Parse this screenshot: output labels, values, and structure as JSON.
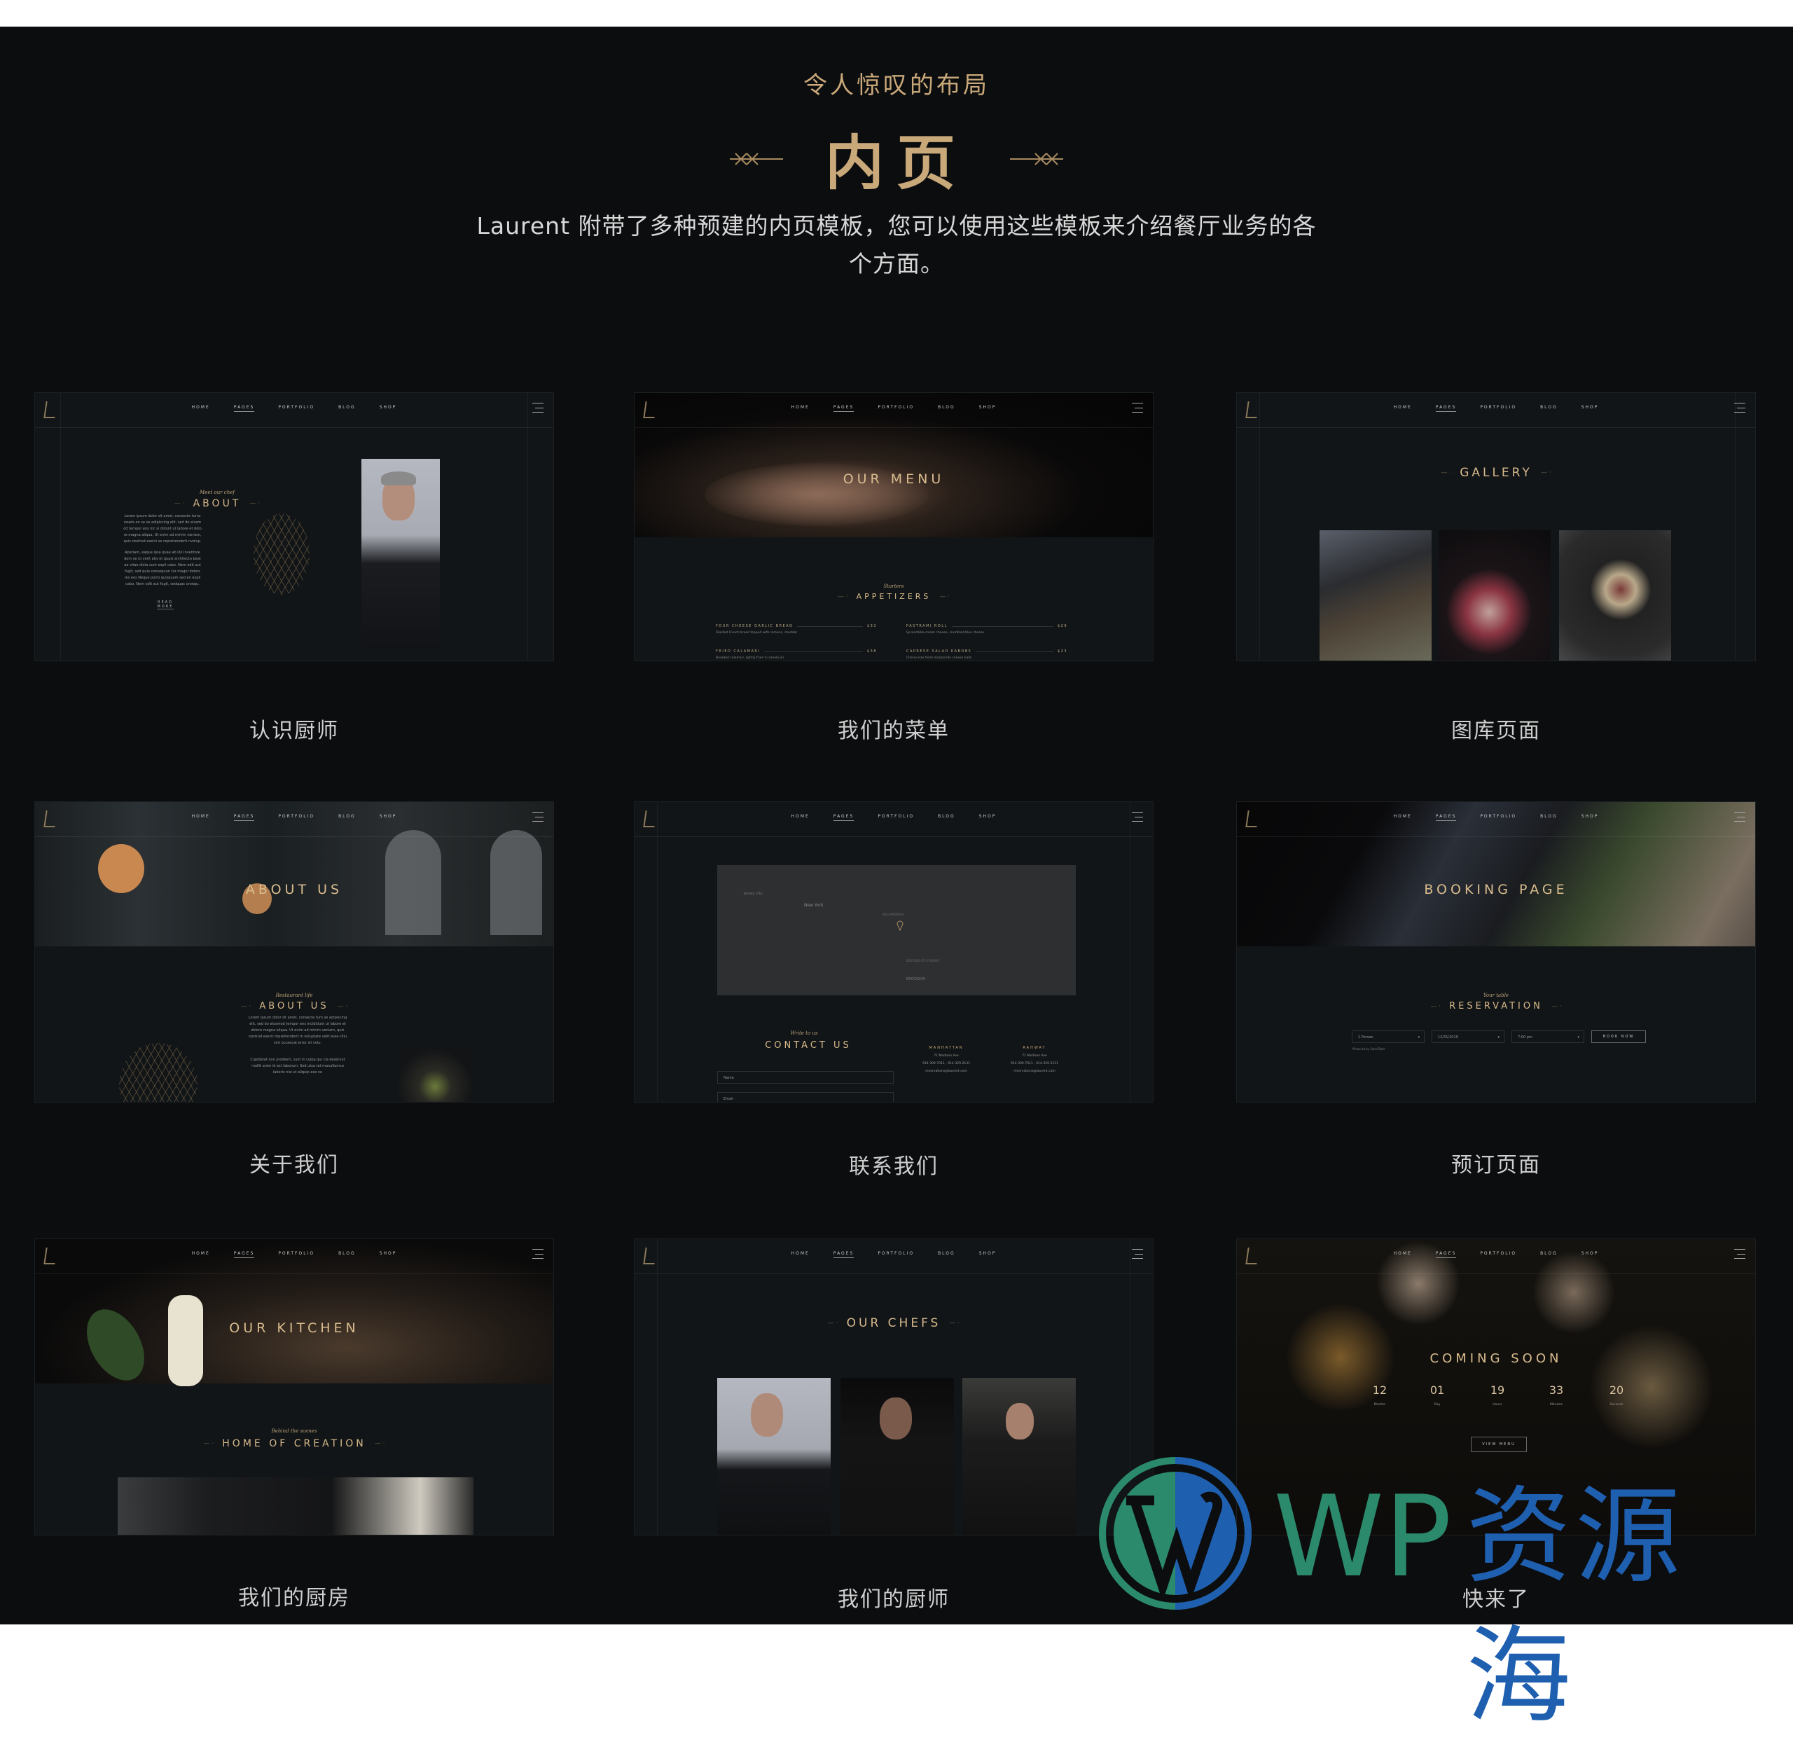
{
  "header": {
    "eyebrow": "令人惊叹的布局",
    "title": "内页",
    "description": "Laurent 附带了多种预建的内页模板，您可以使用这些模板来介绍餐厅业务的各个方面。"
  },
  "site_nav": {
    "items": [
      "HOME",
      "PAGES",
      "PORTFOLIO",
      "BLOG",
      "SHOP"
    ],
    "active": "PAGES"
  },
  "colors": {
    "background": "#0c0d0f",
    "accent_gold": "#c9a87a",
    "caption": "#cfcfcf"
  },
  "cards": [
    {
      "caption": "认识厨师",
      "preview": {
        "script": "Meet our chef",
        "title": "ABOUT",
        "para1": "Lorem ipsum dolor sit amet, consecte turns neads en se se adipiscing elit, sed do eiusm od tempor ens inc si didunt ut labore et dolo re magna aliqua. Ut enim ad minim veniam, quis nostrud exerci se reprehenderit nvolup.",
        "para2": "Aperiam, eaque ipsa quae ab illo inventore dom se ro verit atis et quasi architecto beat ae vitae dicta sunt expli cabo. Nem odit aut fugit, sed quia consequun tur magni dolors res eos Neque porro quisquam sed en expli cabo. Nem odit aut fugit, sedquac oroequ.",
        "link": "READ MORE"
      }
    },
    {
      "caption": "我们的菜单",
      "preview": {
        "hero_title": "OUR MENU",
        "script": "Starters",
        "title": "APPETIZERS",
        "items": [
          {
            "name": "FOUR CHEESE GARLIC BREAD",
            "price": "$32",
            "desc": "Toasted French bread topped with romano, cheddar"
          },
          {
            "name": "PASTRAMI ROLL",
            "price": "$29",
            "desc": "Spreadable cream cheese, crumbled blue cheese"
          },
          {
            "name": "FRIED CALAMARI",
            "price": "$38",
            "desc": "Breaded calamari, lightly fried in canola oil"
          },
          {
            "name": "CAPRESE SALAD KABOBS",
            "price": "$23",
            "desc": "Cherry-size fresh mozzarella cheese balls"
          }
        ]
      }
    },
    {
      "caption": "图库页面",
      "preview": {
        "title": "GALLERY"
      }
    },
    {
      "caption": "关于我们",
      "preview": {
        "hero_title": "ABOUT US",
        "script": "Restaurant life",
        "title": "ABOUT US",
        "para1": "Lorem ipsum dolor sit amet, consecte turn se adipiscing elit, sed do eiusmod tempor ens incididunt ut labore et dolore magna aliqua. Ut enim ad minim veniam, quis nostrud exerci reprehenderit in voluptate velit esse cillu sint occaecat error sit volu.",
        "para2": "Cupidatat non proident, sunt in culpa qui cia deserunt mollit anim id est laborum. Sed utsa tat manullamco laboris nisi ut aliquip exe ne"
      }
    },
    {
      "caption": "联系我们",
      "preview": {
        "map_labels": [
          "New York",
          "Jersey City",
          "BROOKLYN",
          "WILLIAMSBURG",
          "BEDFORD-STUYVESANT"
        ],
        "script": "Write to us",
        "title": "CONTACT US",
        "name_placeholder": "Name",
        "email_placeholder": "Email",
        "locations": [
          {
            "name": "MANHATTAN",
            "address": "71 Madison Ave",
            "phone": "914-309-7011 , 914-329-2131",
            "email": "reservations@laurent.com"
          },
          {
            "name": "RAHWAY",
            "address": "71 Madison Ave",
            "phone": "914-309-7011 , 914-329-2131",
            "email": "reservations@laurent.com"
          }
        ]
      }
    },
    {
      "caption": "预订页面",
      "preview": {
        "hero_title": "BOOKING PAGE",
        "script": "Your table",
        "title": "RESERVATION",
        "persons": "1 Person",
        "date": "12/31/2019",
        "time": "7:00 pm",
        "button": "BOOK NOW",
        "note": "*Powered by OpenTable"
      }
    },
    {
      "caption": "我们的厨房",
      "preview": {
        "hero_title": "OUR KITCHEN",
        "script": "Behind the scenes",
        "title": "HOME OF CREATION"
      }
    },
    {
      "caption": "我们的厨师",
      "preview": {
        "title": "OUR CHEFS"
      }
    },
    {
      "caption": "快来了",
      "preview": {
        "title": "COMING SOON",
        "countdown": [
          {
            "value": "12",
            "label": "Months"
          },
          {
            "value": "01",
            "label": "Day"
          },
          {
            "value": "19",
            "label": "Hours"
          },
          {
            "value": "33",
            "label": "Minutes"
          },
          {
            "value": "20",
            "label": "Seconds"
          }
        ],
        "button": "VIEW MENU"
      }
    }
  ],
  "watermark": {
    "latin": "WP",
    "cjk": "资源海"
  }
}
